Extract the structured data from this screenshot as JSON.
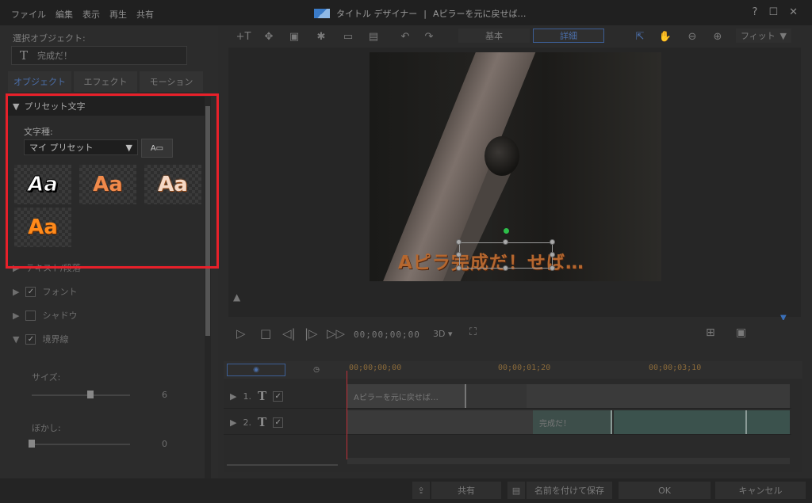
{
  "window": {
    "menu": [
      "ファイル",
      "編集",
      "表示",
      "再生",
      "共有"
    ],
    "title": "タイトル デザイナー",
    "separator": "|",
    "doc_title": "Aピラーを元に戻せば…",
    "controls": {
      "help": "?",
      "maximize": "☐",
      "close": "✕"
    }
  },
  "left": {
    "selected_label": "選択オブジェクト:",
    "selected_value": "完成だ！",
    "tabs": [
      "オブジェクト",
      "エフェクト",
      "モーション"
    ],
    "preset": {
      "header": "プリセット文字",
      "font_kind_label": "文字種:",
      "dropdown_value": "マイ プリセット",
      "tiles": [
        "Aa",
        "Aa",
        "Aa",
        "Aa"
      ]
    },
    "sections": {
      "text_paragraph": "テキスト/段落",
      "font": "フォント",
      "shadow": "シャドウ",
      "border": "境界線"
    },
    "border": {
      "size_label": "サイズ:",
      "size_value": "6",
      "blur_label": "ぼかし:",
      "blur_value": "0"
    }
  },
  "toolbar": {
    "mode_basic": "基本",
    "mode_detail": "詳細",
    "fit": "フィット"
  },
  "preview": {
    "overlay_text_left": "Aピラ",
    "overlay_text_selected": "完成だ！",
    "overlay_text_right": "せば…"
  },
  "playback": {
    "timecode": "00;00;00;00",
    "mode_3d": "3D"
  },
  "timeline": {
    "ruler": [
      "00;00;00;00",
      "00;00;01;20",
      "00;00;03;10"
    ],
    "tracks": [
      {
        "num": "1.",
        "clip": "Aピラーを元に戻せば…"
      },
      {
        "num": "2.",
        "clip": "完成だ！"
      }
    ]
  },
  "bottom": {
    "share": "共有",
    "save_as": "名前を付けて保存",
    "ok": "OK",
    "cancel": "キャンセル"
  },
  "colors": {
    "accent_blue": "#4b6ea8",
    "highlight_red": "#e8202a",
    "overlay_text": "#b5672f",
    "playhead": "#c0303a"
  }
}
